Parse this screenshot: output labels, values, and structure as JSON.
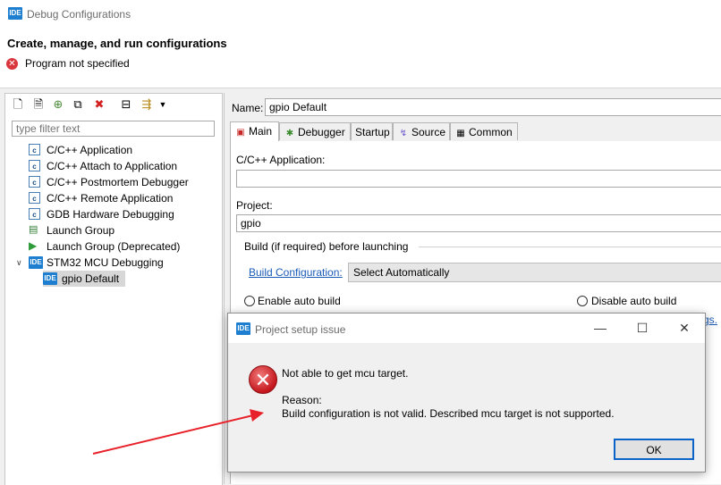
{
  "window": {
    "badge": "IDE",
    "title": "Debug Configurations"
  },
  "header": {
    "title": "Create, manage, and run configurations",
    "error_message": "Program not specified"
  },
  "left": {
    "filter_placeholder": "type filter text",
    "tree": [
      {
        "label": "C/C++ Application",
        "icon": "c-launch-icon"
      },
      {
        "label": "C/C++ Attach to Application",
        "icon": "c-launch-icon"
      },
      {
        "label": "C/C++ Postmortem Debugger",
        "icon": "c-launch-icon"
      },
      {
        "label": "C/C++ Remote Application",
        "icon": "c-launch-icon"
      },
      {
        "label": "GDB Hardware Debugging",
        "icon": "c-launch-icon"
      },
      {
        "label": "Launch Group",
        "icon": "launch-group-icon"
      },
      {
        "label": "Launch Group (Deprecated)",
        "icon": "launch-group-deprecated-icon"
      },
      {
        "label": "STM32 MCU Debugging",
        "icon": "ide-icon",
        "expanded": true
      },
      {
        "label": "gpio Default",
        "icon": "ide-icon",
        "selected": true
      }
    ]
  },
  "main": {
    "name_label": "Name:",
    "name_value": "gpio Default",
    "tabs": [
      {
        "label": "Main",
        "icon": "main-tab-icon"
      },
      {
        "label": "Debugger",
        "icon": "bug-icon"
      },
      {
        "label": "Startup",
        "icon": ""
      },
      {
        "label": "Source",
        "icon": "source-icon"
      },
      {
        "label": "Common",
        "icon": "common-icon"
      }
    ],
    "app_label": "C/C++ Application:",
    "app_value": "",
    "project_label": "Project:",
    "project_value": "gpio",
    "build_group_title": "Build (if required) before launching",
    "build_config_link": "Build Configuration:",
    "build_config_value": "Select Automatically",
    "radio_enable": "Enable auto build",
    "radio_disable": "Disable auto build",
    "partial_link": "gs."
  },
  "dialog": {
    "badge": "IDE",
    "title": "Project setup issue",
    "message": "Not able to get mcu target.",
    "reason_label": "Reason:",
    "reason_text": "Build configuration is not valid. Described mcu target is not supported.",
    "ok_label": "OK"
  },
  "colors": {
    "accent": "#1e7fd0",
    "error": "#d9363e",
    "link": "#1a5bb8",
    "arrow": "#e8202a"
  }
}
